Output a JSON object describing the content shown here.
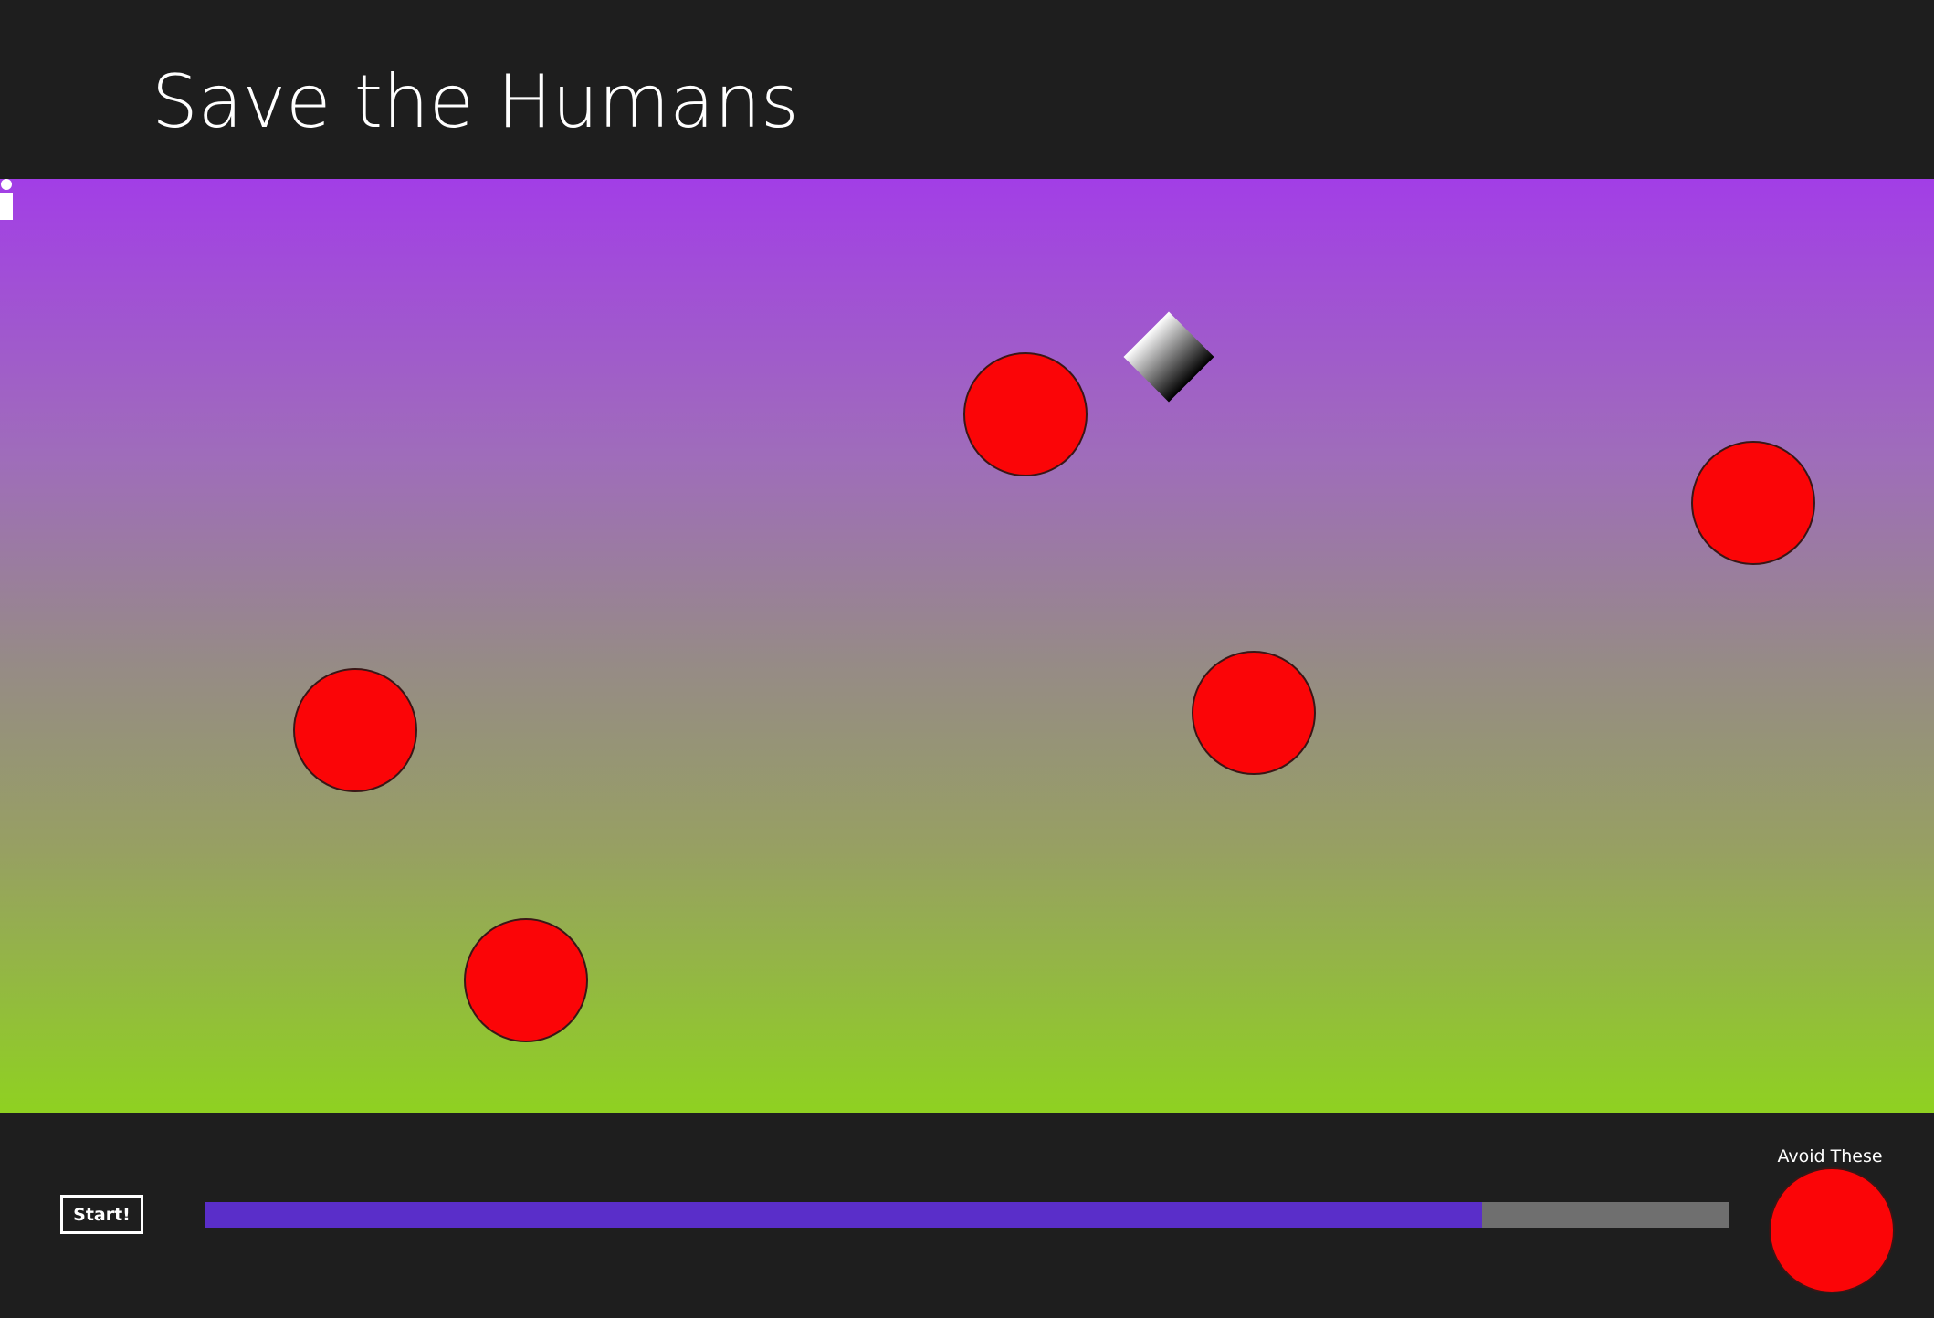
{
  "app": {
    "title": "Save the Humans"
  },
  "colors": {
    "enemy": "#fb0507",
    "progress_fill": "#5a2ec9",
    "progress_track": "#6f6f6f",
    "background": "#1e1e1e",
    "playarea_gradient": [
      "#a23ee6",
      "#9f6dba",
      "#968b86",
      "#97a062",
      "#8fd121"
    ]
  },
  "game": {
    "human_icon": "human-icon",
    "target_icon": "target-diamond",
    "enemy_icon": "red-circle",
    "enemy_count": 5
  },
  "footer": {
    "start_label": "Start!",
    "progress_fraction": 0.838,
    "avoid_label": "Avoid These"
  }
}
